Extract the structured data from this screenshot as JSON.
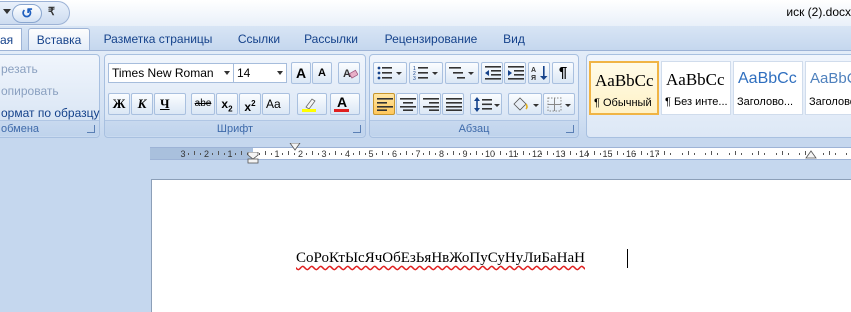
{
  "window": {
    "title": "иск (2).docx"
  },
  "qat": {
    "undo_glyph": "↺",
    "more_glyph": "₹"
  },
  "tabs": [
    {
      "label": "ая"
    },
    {
      "label": "Вставка"
    },
    {
      "label": "Разметка страницы"
    },
    {
      "label": "Ссылки"
    },
    {
      "label": "Рассылки"
    },
    {
      "label": "Рецензирование"
    },
    {
      "label": "Вид"
    }
  ],
  "clipboard": {
    "cut": "резать",
    "copy": "опировать",
    "format_painter": "ормат по образцу",
    "label": "обмена"
  },
  "font": {
    "label": "Шрифт",
    "name": "Times New Roman",
    "size": "14",
    "grow": "A",
    "shrink": "A",
    "bold": "Ж",
    "italic": "К",
    "underline": "Ч",
    "strike": "abe",
    "subscript": "x",
    "sub_mark": "2",
    "superscript": "x",
    "sup_mark": "2",
    "change_case": "Aa",
    "font_color_letter": "A",
    "highlight_color": "#ffff00",
    "font_color": "#e02020"
  },
  "paragraph": {
    "label": "Абзац",
    "pilcrow": "¶"
  },
  "styles": [
    {
      "sample": "AaBbCc",
      "name": "¶ Обычный"
    },
    {
      "sample": "AaBbCc",
      "name": "¶ Без инте..."
    },
    {
      "sample": "AaBbCc",
      "name": "Заголово..."
    },
    {
      "sample": "AaBbCc",
      "name": "Заголовок"
    }
  ],
  "ruler": {
    "left_numbers": [
      "3",
      "2",
      "1"
    ],
    "right_numbers": [
      "1",
      "2",
      "3",
      "4",
      "5",
      "6",
      "7",
      "8",
      "9",
      "10",
      "11",
      "12",
      "13",
      "14",
      "15",
      "16",
      "17"
    ]
  },
  "document": {
    "text": "СоРоКтЫсЯчОбЕзЬяНвЖоПуСуНуЛиБаНаН"
  },
  "colors": {
    "ribbon_bg": "#c5d7ee",
    "tab_text": "#15428b",
    "selected_style_border": "#f0b445",
    "spell_underline": "#e02020"
  }
}
